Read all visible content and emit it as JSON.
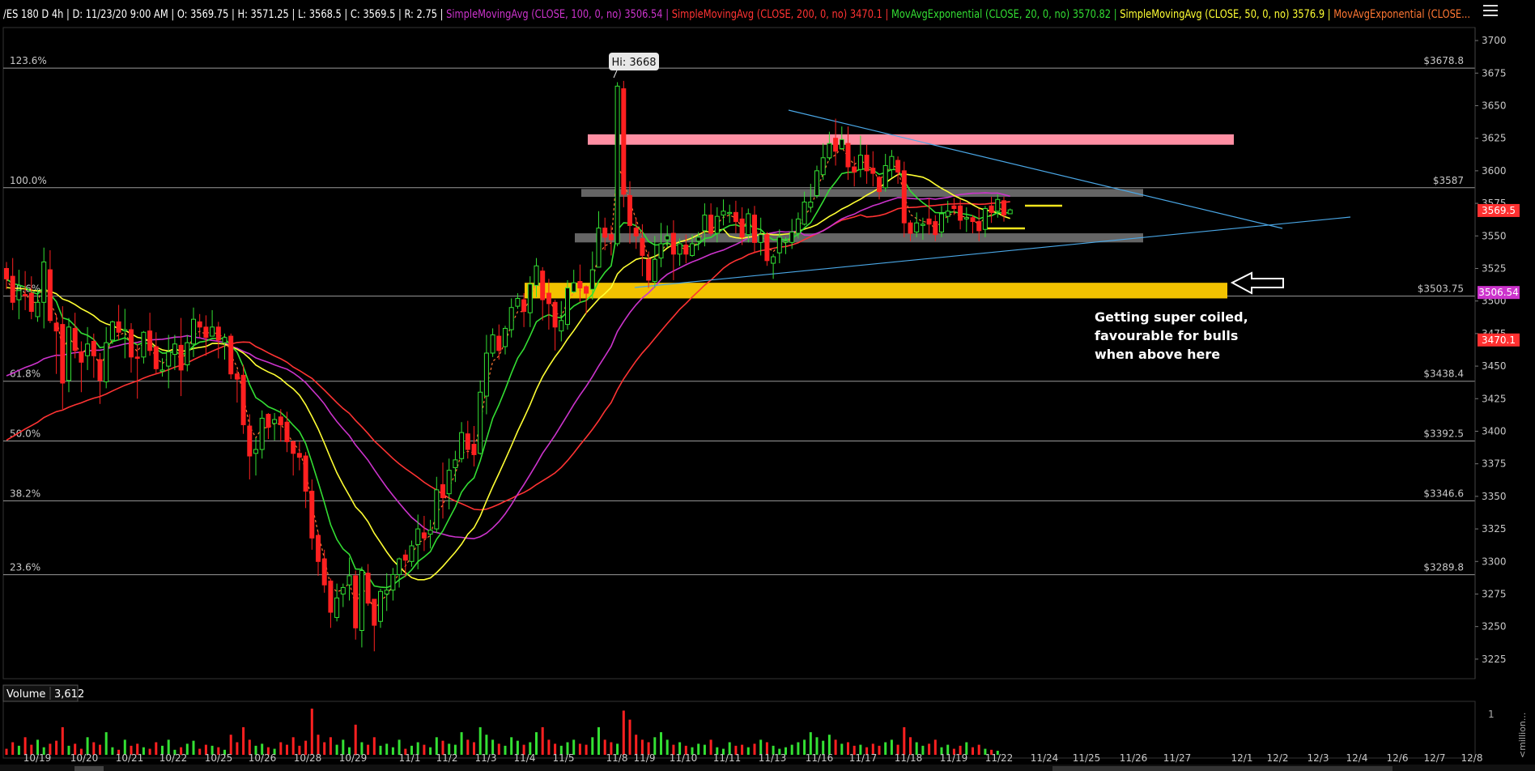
{
  "header": {
    "symbol": "/ES 180 D 4h",
    "date": "D: 11/23/20 9:00 AM",
    "open": "O: 3569.75",
    "high": "H: 3571.25",
    "low": "L: 3568.5",
    "close": "C: 3569.5",
    "range": "R: 2.75",
    "studies": [
      {
        "label": "SimpleMovingAvg (CLOSE, 100, 0, no)",
        "value": "3506.54",
        "color": "#cc33cc"
      },
      {
        "label": "SimpleMovingAvg (CLOSE, 200, 0, no)",
        "value": "3470.1",
        "color": "#ff3333"
      },
      {
        "label": "MovAvgExponential (CLOSE, 20, 0, no)",
        "value": "3570.82",
        "color": "#33dd33"
      },
      {
        "label": "SimpleMovingAvg (CLOSE, 50, 0, no)",
        "value": "3576.9",
        "color": "#ffff33"
      },
      {
        "label": "MovAvgExponential (CLOSE...",
        "value": "",
        "color": "#ff7733"
      }
    ]
  },
  "annotation": {
    "hi_label": "Hi: 3668",
    "note_lines": [
      "Getting super coiled,",
      "favourable for bulls",
      "when above here"
    ]
  },
  "volume": {
    "label": "Volume",
    "value": "3,612",
    "axis_label": "1",
    "unit_label": "<million..."
  },
  "chart_data": {
    "type": "candlestick",
    "y_range": [
      3210,
      3710
    ],
    "y_ticks": [
      3225,
      3250,
      3275,
      3300,
      3325,
      3350,
      3375,
      3400,
      3425,
      3450,
      3475,
      3500,
      3525,
      3550,
      3575,
      3600,
      3625,
      3650,
      3675,
      3700
    ],
    "x_labels": [
      "10/19",
      "10/20",
      "10/21",
      "10/22",
      "10/25",
      "10/26",
      "10/28",
      "10/29",
      "11/1",
      "11/2",
      "11/3",
      "11/4",
      "11/5",
      "11/8",
      "11/9",
      "11/10",
      "11/11",
      "11/13",
      "11/16",
      "11/17",
      "11/18",
      "11/19",
      "11/22",
      "11/24",
      "11/25",
      "11/26",
      "11/27",
      "12/1",
      "12/2",
      "12/3",
      "12/4",
      "12/6",
      "12/7",
      "12/8"
    ],
    "fib_levels": [
      {
        "pct": "123.6%",
        "price": 3678.8,
        "label": "$3678.8"
      },
      {
        "pct": "100.0%",
        "price": 3587,
        "label": "$3587"
      },
      {
        "pct": "78.6%",
        "price": 3503.75,
        "label": "$3503.75"
      },
      {
        "pct": "61.8%",
        "price": 3438.4,
        "label": "$3438.4"
      },
      {
        "pct": "50.0%",
        "price": 3392.5,
        "label": "$3392.5"
      },
      {
        "pct": "38.2%",
        "price": 3346.6,
        "label": "$3346.6"
      },
      {
        "pct": "23.6%",
        "price": 3289.8,
        "label": "$3289.8"
      }
    ],
    "price_tags": [
      {
        "value": "3569.5",
        "price": 3569.5,
        "bg": "#ff3030",
        "fg": "#ffffff"
      },
      {
        "value": "3506.54",
        "price": 3506.54,
        "bg": "#cc33cc",
        "fg": "#ffffff"
      },
      {
        "value": "3470.1",
        "price": 3470.1,
        "bg": "#ff3030",
        "fg": "#ffffff"
      }
    ],
    "zones": [
      {
        "name": "resistance-pink",
        "from_price": 3620,
        "to_price": 3628,
        "color": "#ff8fa3"
      },
      {
        "name": "zone-gray-top",
        "from_price": 3580,
        "to_price": 3586,
        "color": "#777777"
      },
      {
        "name": "zone-gray-bottom",
        "from_price": 3545,
        "to_price": 3552,
        "color": "#777777"
      },
      {
        "name": "support-yellow",
        "from_price": 3502,
        "to_price": 3514,
        "color": "#f2c200"
      }
    ],
    "candles": [
      [
        3525,
        3517,
        3530,
        3509
      ],
      [
        3519,
        3499,
        3533,
        3493
      ],
      [
        3501,
        3508,
        3524,
        3486
      ],
      [
        3505,
        3504,
        3523,
        3493
      ],
      [
        3506,
        3492,
        3519,
        3486
      ],
      [
        3488,
        3499,
        3509,
        3484
      ],
      [
        3499,
        3530,
        3541,
        3479
      ],
      [
        3524,
        3485,
        3539,
        3483
      ],
      [
        3483,
        3477,
        3490,
        3444
      ],
      [
        3482,
        3437,
        3496,
        3417
      ],
      [
        3439,
        3480,
        3487,
        3430
      ],
      [
        3479,
        3462,
        3491,
        3456
      ],
      [
        3461,
        3453,
        3469,
        3430
      ],
      [
        3458,
        3467,
        3480,
        3447
      ],
      [
        3469,
        3458,
        3475,
        3441
      ],
      [
        3455,
        3439,
        3460,
        3421
      ],
      [
        3438,
        3468,
        3480,
        3433
      ],
      [
        3470,
        3484,
        3485,
        3467
      ],
      [
        3484,
        3476,
        3497,
        3470
      ],
      [
        3478,
        3478,
        3494,
        3456
      ],
      [
        3478,
        3457,
        3483,
        3445
      ],
      [
        3457,
        3456,
        3467,
        3425
      ],
      [
        3457,
        3476,
        3477,
        3452
      ],
      [
        3477,
        3462,
        3491,
        3458
      ],
      [
        3465,
        3448,
        3476,
        3444
      ],
      [
        3447,
        3447,
        3456,
        3442
      ],
      [
        3450,
        3461,
        3474,
        3433
      ],
      [
        3459,
        3467,
        3474,
        3447
      ],
      [
        3466,
        3447,
        3487,
        3427
      ],
      [
        3451,
        3468,
        3474,
        3446
      ],
      [
        3467,
        3486,
        3495,
        3457
      ],
      [
        3484,
        3480,
        3490,
        3472
      ],
      [
        3480,
        3472,
        3489,
        3458
      ],
      [
        3473,
        3480,
        3493,
        3473
      ],
      [
        3480,
        3470,
        3484,
        3456
      ],
      [
        3468,
        3472,
        3475,
        3455
      ],
      [
        3473,
        3444,
        3475,
        3440
      ],
      [
        3444,
        3440,
        3447,
        3422
      ],
      [
        3443,
        3405,
        3451,
        3398
      ],
      [
        3404,
        3381,
        3413,
        3363
      ],
      [
        3383,
        3386,
        3395,
        3366
      ],
      [
        3386,
        3410,
        3416,
        3379
      ],
      [
        3413,
        3403,
        3414,
        3394
      ],
      [
        3406,
        3409,
        3414,
        3393
      ],
      [
        3411,
        3405,
        3417,
        3392
      ],
      [
        3407,
        3392,
        3415,
        3384
      ],
      [
        3392,
        3383,
        3393,
        3366
      ],
      [
        3383,
        3380,
        3392,
        3370
      ],
      [
        3381,
        3354,
        3384,
        3341
      ],
      [
        3354,
        3318,
        3363,
        3309
      ],
      [
        3320,
        3300,
        3323,
        3289
      ],
      [
        3302,
        3282,
        3309,
        3276
      ],
      [
        3285,
        3261,
        3287,
        3249
      ],
      [
        3257,
        3272,
        3283,
        3254
      ],
      [
        3275,
        3280,
        3283,
        3265
      ],
      [
        3282,
        3289,
        3303,
        3270
      ],
      [
        3289,
        3249,
        3293,
        3240
      ],
      [
        3247,
        3293,
        3296,
        3234
      ],
      [
        3291,
        3268,
        3298,
        3266
      ],
      [
        3271,
        3251,
        3271,
        3231
      ],
      [
        3254,
        3277,
        3279,
        3249
      ],
      [
        3275,
        3278,
        3291,
        3262
      ],
      [
        3278,
        3290,
        3295,
        3270
      ],
      [
        3290,
        3302,
        3303,
        3280
      ],
      [
        3305,
        3301,
        3309,
        3288
      ],
      [
        3300,
        3312,
        3316,
        3296
      ],
      [
        3313,
        3325,
        3336,
        3294
      ],
      [
        3322,
        3318,
        3335,
        3308
      ],
      [
        3321,
        3324,
        3332,
        3310
      ],
      [
        3325,
        3355,
        3365,
        3322
      ],
      [
        3359,
        3349,
        3376,
        3333
      ],
      [
        3352,
        3370,
        3379,
        3340
      ],
      [
        3372,
        3378,
        3385,
        3361
      ],
      [
        3379,
        3399,
        3407,
        3376
      ],
      [
        3398,
        3386,
        3408,
        3379
      ],
      [
        3390,
        3382,
        3404,
        3373
      ],
      [
        3383,
        3430,
        3439,
        3382
      ],
      [
        3427,
        3460,
        3474,
        3413
      ],
      [
        3460,
        3474,
        3479,
        3457
      ],
      [
        3473,
        3462,
        3482,
        3455
      ],
      [
        3465,
        3479,
        3481,
        3459
      ],
      [
        3478,
        3495,
        3502,
        3472
      ],
      [
        3496,
        3502,
        3506,
        3494
      ],
      [
        3501,
        3492,
        3506,
        3480
      ],
      [
        3491,
        3513,
        3519,
        3480
      ],
      [
        3512,
        3527,
        3533,
        3503
      ],
      [
        3523,
        3501,
        3526,
        3485
      ],
      [
        3506,
        3498,
        3517,
        3478
      ],
      [
        3499,
        3480,
        3501,
        3462
      ],
      [
        3477,
        3485,
        3500,
        3469
      ],
      [
        3482,
        3510,
        3516,
        3478
      ],
      [
        3507,
        3514,
        3524,
        3506
      ],
      [
        3515,
        3510,
        3528,
        3499
      ],
      [
        3511,
        3506,
        3512,
        3490
      ],
      [
        3509,
        3524,
        3538,
        3501
      ],
      [
        3526,
        3556,
        3569,
        3526
      ],
      [
        3556,
        3549,
        3564,
        3539
      ],
      [
        3551,
        3547,
        3558,
        3535
      ],
      [
        3544,
        3665,
        3668,
        3542
      ],
      [
        3663,
        3582,
        3669,
        3572
      ],
      [
        3581,
        3558,
        3592,
        3544
      ],
      [
        3556,
        3550,
        3564,
        3540
      ],
      [
        3548,
        3535,
        3559,
        3519
      ],
      [
        3532,
        3516,
        3538,
        3510
      ],
      [
        3515,
        3532,
        3550,
        3510
      ],
      [
        3533,
        3544,
        3560,
        3526
      ],
      [
        3547,
        3550,
        3558,
        3541
      ],
      [
        3552,
        3536,
        3562,
        3516
      ],
      [
        3536,
        3544,
        3548,
        3527
      ],
      [
        3543,
        3536,
        3551,
        3529
      ],
      [
        3535,
        3544,
        3551,
        3534
      ],
      [
        3546,
        3549,
        3553,
        3539
      ],
      [
        3554,
        3566,
        3575,
        3542
      ],
      [
        3566,
        3552,
        3575,
        3550
      ],
      [
        3552,
        3565,
        3572,
        3545
      ],
      [
        3566,
        3569,
        3578,
        3558
      ],
      [
        3568,
        3568,
        3574,
        3560
      ],
      [
        3568,
        3561,
        3577,
        3552
      ],
      [
        3563,
        3549,
        3572,
        3543
      ],
      [
        3551,
        3567,
        3571,
        3545
      ],
      [
        3566,
        3545,
        3573,
        3537
      ],
      [
        3545,
        3551,
        3564,
        3535
      ],
      [
        3551,
        3531,
        3553,
        3527
      ],
      [
        3529,
        3534,
        3536,
        3517
      ],
      [
        3537,
        3549,
        3555,
        3529
      ],
      [
        3546,
        3546,
        3549,
        3536
      ],
      [
        3545,
        3553,
        3563,
        3540
      ],
      [
        3552,
        3563,
        3568,
        3548
      ],
      [
        3559,
        3576,
        3584,
        3558
      ],
      [
        3572,
        3576,
        3590,
        3568
      ],
      [
        3581,
        3600,
        3604,
        3579
      ],
      [
        3597,
        3610,
        3621,
        3593
      ],
      [
        3610,
        3621,
        3630,
        3608
      ],
      [
        3625,
        3615,
        3640,
        3604
      ],
      [
        3617,
        3624,
        3634,
        3616
      ],
      [
        3621,
        3603,
        3634,
        3593
      ],
      [
        3603,
        3599,
        3611,
        3588
      ],
      [
        3601,
        3612,
        3627,
        3595
      ],
      [
        3612,
        3600,
        3620,
        3590
      ],
      [
        3602,
        3598,
        3615,
        3588
      ],
      [
        3595,
        3584,
        3596,
        3578
      ],
      [
        3587,
        3604,
        3613,
        3584
      ],
      [
        3601,
        3611,
        3616,
        3595
      ],
      [
        3608,
        3599,
        3611,
        3590
      ],
      [
        3600,
        3560,
        3607,
        3549
      ],
      [
        3560,
        3552,
        3562,
        3546
      ],
      [
        3553,
        3560,
        3568,
        3549
      ],
      [
        3559,
        3559,
        3564,
        3547
      ],
      [
        3563,
        3559,
        3579,
        3551
      ],
      [
        3561,
        3551,
        3566,
        3546
      ],
      [
        3553,
        3567,
        3573,
        3549
      ],
      [
        3565,
        3569,
        3577,
        3560
      ],
      [
        3573,
        3571,
        3579,
        3566
      ],
      [
        3573,
        3562,
        3578,
        3555
      ],
      [
        3563,
        3564,
        3572,
        3553
      ],
      [
        3564,
        3561,
        3566,
        3552
      ],
      [
        3561,
        3554,
        3571,
        3546
      ],
      [
        3555,
        3571,
        3573,
        3549
      ],
      [
        3573,
        3568,
        3580,
        3560
      ],
      [
        3569,
        3578,
        3582,
        3564
      ],
      [
        3577,
        3566,
        3580,
        3561
      ],
      [
        3567,
        3570,
        3571,
        3567
      ]
    ],
    "volume_values": [
      0.12,
      0.25,
      0.18,
      0.35,
      0.2,
      0.3,
      0.15,
      0.22,
      0.28,
      0.55,
      0.18,
      0.22,
      0.12,
      0.35,
      0.25,
      0.2,
      0.45,
      0.15,
      0.1,
      0.3,
      0.18,
      0.22,
      0.15,
      0.12,
      0.25,
      0.18,
      0.3,
      0.1,
      0.15,
      0.22,
      0.28,
      0.12,
      0.2,
      0.18,
      0.15,
      0.1,
      0.4,
      0.25,
      0.55,
      0.3,
      0.18,
      0.22,
      0.15,
      0.12,
      0.25,
      0.2,
      0.35,
      0.18,
      0.28,
      0.92,
      0.4,
      0.25,
      0.35,
      0.2,
      0.3,
      0.15,
      0.6,
      0.25,
      0.2,
      0.35,
      0.18,
      0.22,
      0.15,
      0.3,
      0.12,
      0.18,
      0.25,
      0.2,
      0.15,
      0.35,
      0.28,
      0.22,
      0.2,
      0.45,
      0.3,
      0.25,
      0.55,
      0.4,
      0.3,
      0.22,
      0.18,
      0.35,
      0.28,
      0.2,
      0.25,
      0.45,
      0.55,
      0.3,
      0.22,
      0.18,
      0.25,
      0.3,
      0.22,
      0.2,
      0.35,
      0.55,
      0.3,
      0.25,
      0.22,
      0.88,
      0.7,
      0.4,
      0.3,
      0.25,
      0.35,
      0.45,
      0.3,
      0.2,
      0.25,
      0.18,
      0.15,
      0.22,
      0.2,
      0.3,
      0.15,
      0.12,
      0.25,
      0.18,
      0.2,
      0.15,
      0.22,
      0.3,
      0.25,
      0.18,
      0.12,
      0.15,
      0.2,
      0.25,
      0.3,
      0.45,
      0.35,
      0.28,
      0.4,
      0.3,
      0.22,
      0.25,
      0.18,
      0.2,
      0.15,
      0.22,
      0.18,
      0.25,
      0.3,
      0.2,
      0.55,
      0.35,
      0.25,
      0.18,
      0.22,
      0.3,
      0.15,
      0.2,
      0.12,
      0.18,
      0.25,
      0.15,
      0.2,
      0.12,
      0.1,
      0.08
    ]
  }
}
